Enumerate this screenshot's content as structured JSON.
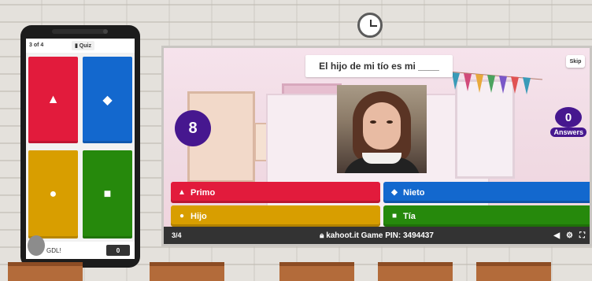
{
  "game": {
    "question": "El hijo de mi tío es mi ____",
    "skip_label": "Skip",
    "timer": "8",
    "answers_count": "0",
    "answers_label": "Answers",
    "options": [
      {
        "label": "Primo",
        "symbol": "triangle",
        "color": "#e21b3c"
      },
      {
        "label": "Nieto",
        "symbol": "diamond",
        "color": "#1368ce"
      },
      {
        "label": "Hijo",
        "symbol": "circle",
        "color": "#d89e00"
      },
      {
        "label": "Tía",
        "symbol": "square",
        "color": "#26890c"
      }
    ],
    "question_counter": "3/4",
    "pin_text": "kahoot.it Game PIN: 3494437"
  },
  "phone": {
    "question_counter": "3 of 4",
    "quiz_label": "Quiz",
    "player_name": "GDL!",
    "score": "0"
  },
  "icons": [
    "clock-icon",
    "lock-icon",
    "volume-icon",
    "settings-icon",
    "fullscreen-icon",
    "triangle-icon",
    "diamond-icon",
    "circle-icon",
    "square-icon",
    "avatar-icon"
  ]
}
